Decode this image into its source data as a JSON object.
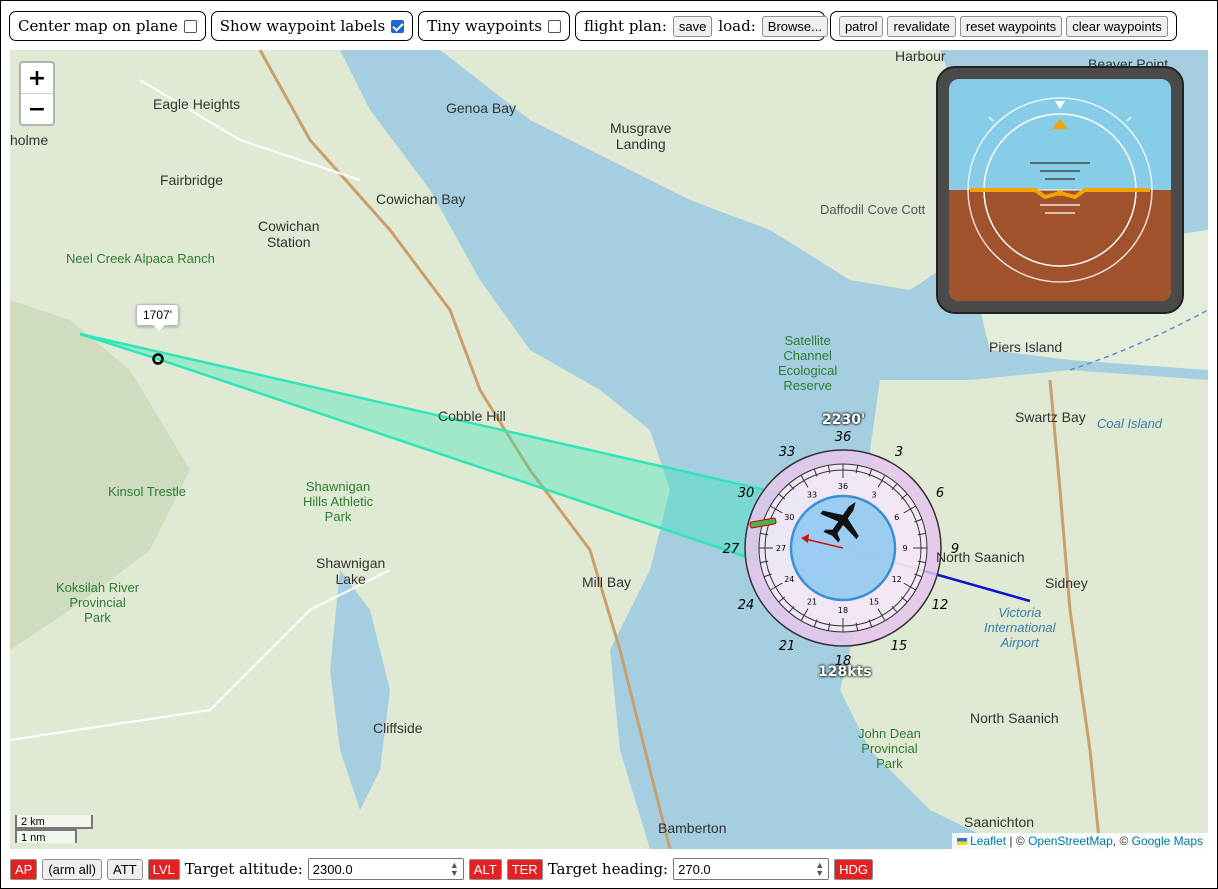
{
  "toolbar": {
    "center_map_label": "Center map on plane",
    "center_map_checked": false,
    "show_labels_label": "Show waypoint labels",
    "show_labels_checked": true,
    "tiny_waypoints_label": "Tiny waypoints",
    "tiny_waypoints_checked": false,
    "flight_plan_label": "flight plan:",
    "save_label": "save",
    "load_label": "load:",
    "browse_label": "Browse...",
    "patrol_label": "patrol",
    "revalidate_label": "revalidate",
    "reset_label": "reset waypoints",
    "clear_label": "clear waypoints"
  },
  "map": {
    "zoom_in": "+",
    "zoom_out": "−",
    "waypoint_label": "1707'",
    "altitude_readout": "2230'",
    "speed_readout": "128kts",
    "scale_km": "2 km",
    "scale_nm": "1 nm",
    "attribution": {
      "leaflet": "Leaflet",
      "sep1": " | © ",
      "osm": "OpenStreetMap",
      "sep2": ", © ",
      "google": "Google Maps"
    },
    "place_labels": [
      {
        "id": "eagle-heights",
        "text": "Eagle Heights",
        "cls": "town"
      },
      {
        "id": "genoa-bay",
        "text": "Genoa Bay",
        "cls": "town"
      },
      {
        "id": "musgrave-landing",
        "text": "Musgrave\nLanding",
        "cls": "town"
      },
      {
        "id": "harbour",
        "text": "Harbour",
        "cls": "town"
      },
      {
        "id": "beaver-point",
        "text": "Beaver Point",
        "cls": "town"
      },
      {
        "id": "fairbridge",
        "text": "Fairbridge",
        "cls": "town"
      },
      {
        "id": "cowichan-bay",
        "text": "Cowichan Bay",
        "cls": "town"
      },
      {
        "id": "cowichan-station",
        "text": "Cowichan\nStation",
        "cls": "town"
      },
      {
        "id": "neel-creek",
        "text": "Neel Creek Alpaca Ranch",
        "cls": "park"
      },
      {
        "id": "daffodil",
        "text": "Daffodil Cove Cott",
        "cls": "poi"
      },
      {
        "id": "satellite-channel",
        "text": "Satellite\nChannel\nEcological\nReserve",
        "cls": "park"
      },
      {
        "id": "piers-island",
        "text": "Piers Island",
        "cls": "town"
      },
      {
        "id": "swartz-bay",
        "text": "Swartz Bay",
        "cls": "town"
      },
      {
        "id": "coal-island",
        "text": "Coal Island",
        "cls": "water"
      },
      {
        "id": "cobble-hill",
        "text": "Cobble Hill",
        "cls": "town"
      },
      {
        "id": "kinsol-trestle",
        "text": "Kinsol Trestle",
        "cls": "park"
      },
      {
        "id": "shawnigan-hills",
        "text": "Shawnigan\nHills Athletic\nPark",
        "cls": "park"
      },
      {
        "id": "victoria-airport",
        "text": "Victoria\nInternational\nAirport",
        "cls": "water"
      },
      {
        "id": "north-saanich",
        "text": "North Saanich",
        "cls": "town"
      },
      {
        "id": "sidney",
        "text": "Sidney",
        "cls": "town"
      },
      {
        "id": "shawnigan-lake",
        "text": "Shawnigan\nLake",
        "cls": "town"
      },
      {
        "id": "mill-bay",
        "text": "Mill Bay",
        "cls": "town"
      },
      {
        "id": "koksilah",
        "text": "Koksilah River\nProvincial\nPark",
        "cls": "park"
      },
      {
        "id": "north-saanich-2",
        "text": "North Saanich",
        "cls": "town"
      },
      {
        "id": "john-dean",
        "text": "John Dean\nProvincial\nPark",
        "cls": "park"
      },
      {
        "id": "cliffside",
        "text": "Cliffside",
        "cls": "town"
      },
      {
        "id": "bamberton",
        "text": "Bamberton",
        "cls": "town"
      },
      {
        "id": "saanichton",
        "text": "Saanichton",
        "cls": "town"
      },
      {
        "id": "holme",
        "text": "holme",
        "cls": "town"
      }
    ]
  },
  "compass": {
    "outer_labels": [
      "36",
      "3",
      "6",
      "9",
      "12",
      "15",
      "18",
      "21",
      "24",
      "27",
      "30",
      "33"
    ],
    "inner_labels": [
      "36",
      "3",
      "6",
      "9",
      "12",
      "15",
      "18",
      "21",
      "24",
      "27",
      "30",
      "33"
    ]
  },
  "bottombar": {
    "ap": "AP",
    "arm_all": "(arm all)",
    "att": "ATT",
    "lvl": "LVL",
    "target_altitude_label": "Target altitude:",
    "target_altitude_value": "2300.0",
    "alt": "ALT",
    "ter": "TER",
    "target_heading_label": "Target heading:",
    "target_heading_value": "270.0",
    "hdg": "HDG"
  },
  "colors": {
    "water": "#a5cfe0",
    "land": "#dfe9d3",
    "route": "#2ee6b8",
    "heading_line": "#0a14c8",
    "tag_red": "#e52020",
    "sky": "#87cde8",
    "ground": "#a0522d",
    "horizon": "#f5a300"
  }
}
